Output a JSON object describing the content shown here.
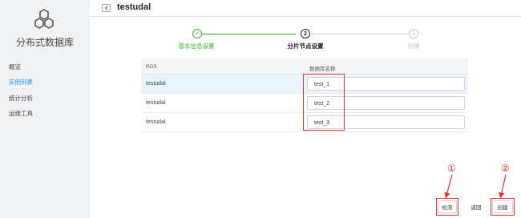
{
  "sidebar": {
    "app_title": "分布式数据库",
    "items": [
      {
        "label": "概览"
      },
      {
        "label": "实例列表"
      },
      {
        "label": "统计分析"
      },
      {
        "label": "运维工具"
      }
    ],
    "active_index": 1,
    "logo_icon": "hexagon-cluster-logo"
  },
  "header": {
    "title": "testudal",
    "back_icon": "chevron-left-icon"
  },
  "steps": [
    {
      "label": "基本信息设置",
      "state": "done",
      "marker": "✓"
    },
    {
      "label": "分片节点设置",
      "state": "current",
      "marker": "2"
    },
    {
      "label": "创建",
      "state": "pending",
      "marker": "3"
    }
  ],
  "table": {
    "headers": [
      "RDS",
      "数据库名称"
    ],
    "rows": [
      {
        "rds": "testudal",
        "db_name": "test_1"
      },
      {
        "rds": "testudal",
        "db_name": "test_2"
      },
      {
        "rds": "testudal",
        "db_name": "test_3"
      }
    ]
  },
  "buttons": {
    "check": "检测",
    "back": "返回",
    "create": "创建"
  },
  "annotations": {
    "marker_1": "①",
    "marker_2": "②",
    "color": "#e0322a"
  },
  "colors": {
    "accent": "#1e88e5",
    "done": "#3cb034",
    "pending": "#c8c8c8"
  }
}
